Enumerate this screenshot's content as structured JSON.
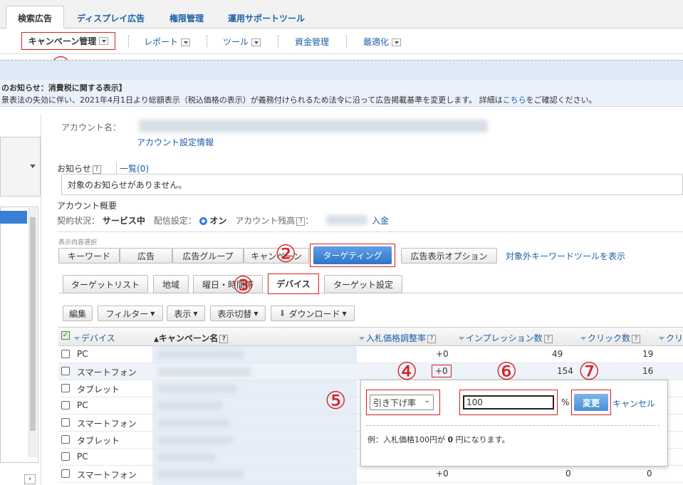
{
  "topTabs": [
    "検索広告",
    "ディスプレイ広告",
    "権限管理",
    "運用サポートツール"
  ],
  "subNav": {
    "campaign": "キャンペーン管理",
    "report": "レポート",
    "tool": "ツール",
    "funds": "資金管理",
    "optimize": "最適化"
  },
  "notice": {
    "title": "のお知らせ：消費税に関する表示】",
    "body_prefix": "景表法の失効に伴い、2021年4月1日より総額表示（税込価格の表示）が義務付けられるため法令に沿って広告掲載基準を変更します。 詳細は",
    "body_link": "こちら",
    "body_suffix": "をご確認ください。"
  },
  "account": {
    "name_label": "アカウント名：",
    "settings_link": "アカウント設定情報",
    "notice_label": "お知らせ",
    "list_link": "一覧(0)",
    "notice_text": "対象のお知らせがありません。",
    "overview_label": "アカウント概要",
    "contract_label": "契約状況：",
    "contract_value": "サービス中",
    "delivery_label": "配信設定：",
    "delivery_value": "オン",
    "balance_label": "アカウント残高",
    "deposit_link": "入金"
  },
  "viewSelect": {
    "label": "表示内容選択",
    "tabs": [
      "キーワード",
      "広告",
      "広告グループ",
      "キャンペーン",
      "ターゲティング",
      "広告表示オプション"
    ],
    "extra_link": "対象外キーワードツールを表示"
  },
  "subTabs": [
    "ターゲットリスト",
    "地域",
    "曜日・時間帯",
    "デバイス",
    "ターゲット設定"
  ],
  "toolbar": {
    "edit": "編集",
    "filter": "フィルター",
    "display": "表示",
    "toggle": "表示切替",
    "download": "ダウンロード"
  },
  "table": {
    "headers": [
      "デバイス",
      "キャンペーン名",
      "入札価格調整率",
      "インプレッション数",
      "クリック数",
      "クリ"
    ],
    "rows": [
      {
        "device": "PC",
        "bid": "+0",
        "imp": "49",
        "click": "19"
      },
      {
        "device": "スマートフォン",
        "bid": "+0",
        "imp": "154",
        "click": "16"
      },
      {
        "device": "タブレット",
        "bid": "",
        "imp": "",
        "click": ""
      },
      {
        "device": "PC",
        "bid": "",
        "imp": "",
        "click": ""
      },
      {
        "device": "スマートフォン",
        "bid": "",
        "imp": "",
        "click": ""
      },
      {
        "device": "タブレット",
        "bid": "",
        "imp": "",
        "click": ""
      },
      {
        "device": "PC",
        "bid": "",
        "imp": "",
        "click": ""
      },
      {
        "device": "スマートフォン",
        "bid": "+0",
        "imp": "0",
        "click": "0"
      }
    ]
  },
  "popup": {
    "select_value": "引き下げ率",
    "input_value": "100",
    "unit": "%",
    "change": "変更",
    "cancel": "キャンセル",
    "example_prefix": "例：入札価格100円が",
    "example_num": "0",
    "example_suffix": "円になります。"
  },
  "markers": [
    "①",
    "②",
    "③",
    "④",
    "⑤",
    "⑥",
    "⑦"
  ],
  "colors": {
    "accent": "#4a90d9",
    "marker": "#d62020",
    "link": "#1a5fa8"
  }
}
